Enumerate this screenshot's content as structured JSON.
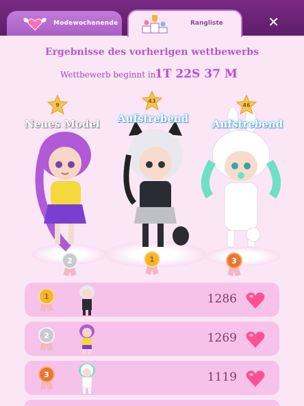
{
  "tabs": [
    {
      "label": "Modewochenende",
      "icon": "heart-wings-icon"
    },
    {
      "label": "Rangliste",
      "icon": "podium-trophy-icon"
    }
  ],
  "close_icon": "close-icon",
  "header": {
    "title": "Ergebnisse des vorherigen wettbewerbs",
    "countdown_label": "Wettbewerb beginnt in",
    "countdown_value": "1T 22S 37 M"
  },
  "podium": [
    {
      "rank": "2",
      "level": "9",
      "title": "Neues Model",
      "medal_color": "#c9c9d2"
    },
    {
      "rank": "1",
      "level": "43",
      "title": "Aufstrebend",
      "medal_color": "#f2b531"
    },
    {
      "rank": "3",
      "level": "46",
      "title": "Aufstrebend",
      "medal_color": "#e8772f"
    }
  ],
  "ranking": [
    {
      "rank": "1",
      "score": "1286",
      "medal_color": "#f2b531"
    },
    {
      "rank": "2",
      "score": "1269",
      "medal_color": "#c9c9d2"
    },
    {
      "rank": "3",
      "score": "1119",
      "medal_color": "#e8772f"
    }
  ],
  "colors": {
    "accent": "#b35bc9",
    "heart": "#ff4f98",
    "row_bg": "#f6c2ea"
  }
}
